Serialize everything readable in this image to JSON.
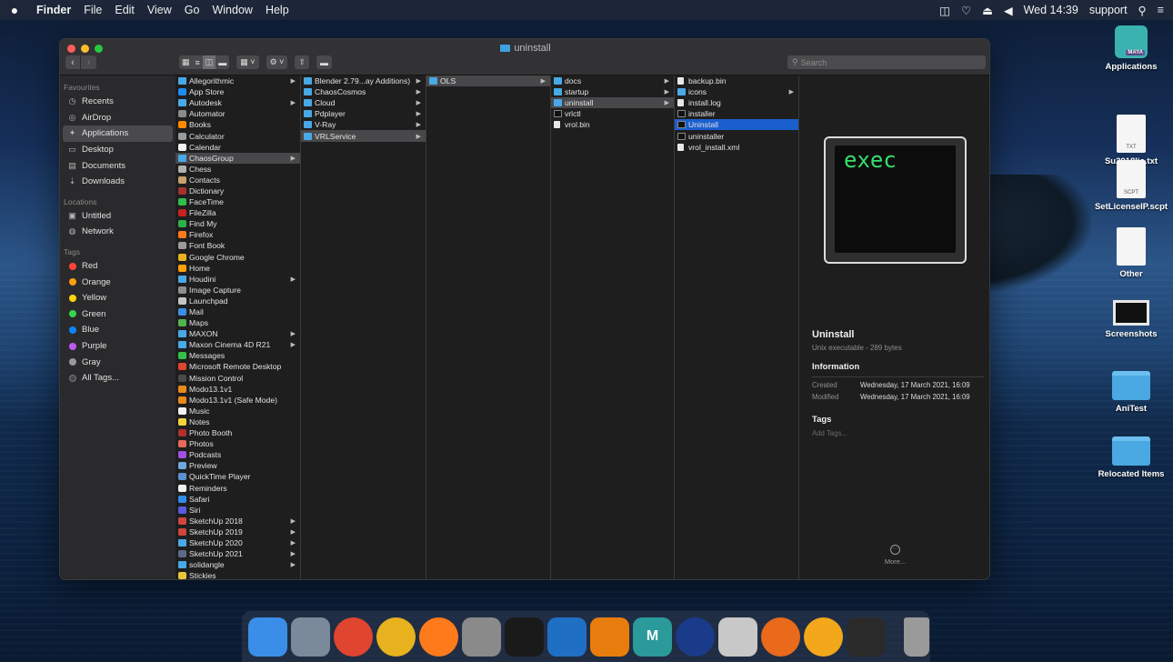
{
  "menubar": {
    "items": [
      "Finder",
      "File",
      "Edit",
      "View",
      "Go",
      "Window",
      "Help"
    ],
    "clock": "Wed 14:39",
    "user": "support"
  },
  "window": {
    "title": "uninstall",
    "search_placeholder": "Search"
  },
  "sidebar": {
    "favourites_heading": "Favourites",
    "favourites": [
      {
        "label": "Recents",
        "icon": "clock-icon"
      },
      {
        "label": "AirDrop",
        "icon": "airdrop-icon"
      },
      {
        "label": "Applications",
        "icon": "applications-icon"
      },
      {
        "label": "Desktop",
        "icon": "desktop-icon"
      },
      {
        "label": "Documents",
        "icon": "documents-icon"
      },
      {
        "label": "Downloads",
        "icon": "downloads-icon"
      }
    ],
    "locations_heading": "Locations",
    "locations": [
      {
        "label": "Untitled",
        "icon": "disk-icon"
      },
      {
        "label": "Network",
        "icon": "globe-icon"
      }
    ],
    "tags_heading": "Tags",
    "tags": [
      {
        "label": "Red",
        "color": "#ff453a"
      },
      {
        "label": "Orange",
        "color": "#ff9f0a"
      },
      {
        "label": "Yellow",
        "color": "#ffd60a"
      },
      {
        "label": "Green",
        "color": "#32d74b"
      },
      {
        "label": "Blue",
        "color": "#0a84ff"
      },
      {
        "label": "Purple",
        "color": "#bf5af2"
      },
      {
        "label": "Gray",
        "color": "#98989d"
      },
      {
        "label": "All Tags...",
        "color": "#4a4a4c"
      }
    ]
  },
  "columns": {
    "applications": [
      {
        "label": "Allegorithmic",
        "type": "folder",
        "chev": true
      },
      {
        "label": "App Store",
        "type": "app",
        "color": "#1c8cf0"
      },
      {
        "label": "Autodesk",
        "type": "folder",
        "chev": true
      },
      {
        "label": "Automator",
        "type": "app",
        "color": "#8a8a8a"
      },
      {
        "label": "Books",
        "type": "app",
        "color": "#ff8a00"
      },
      {
        "label": "Calculator",
        "type": "app",
        "color": "#9a9a9a"
      },
      {
        "label": "Calendar",
        "type": "app",
        "color": "#f2f2f2"
      },
      {
        "label": "ChaosGroup",
        "type": "folder",
        "chev": true,
        "path": true
      },
      {
        "label": "Chess",
        "type": "app",
        "color": "#b0b0b0"
      },
      {
        "label": "Contacts",
        "type": "app",
        "color": "#c8a06a"
      },
      {
        "label": "Dictionary",
        "type": "app",
        "color": "#a5322e"
      },
      {
        "label": "FaceTime",
        "type": "app",
        "color": "#2fbf4a"
      },
      {
        "label": "FileZilla",
        "type": "app",
        "color": "#c7231e"
      },
      {
        "label": "Find My",
        "type": "app",
        "color": "#2cb24a"
      },
      {
        "label": "Firefox",
        "type": "app",
        "color": "#ff7a1a"
      },
      {
        "label": "Font Book",
        "type": "app",
        "color": "#9a9a9a"
      },
      {
        "label": "Google Chrome",
        "type": "app",
        "color": "#e8b21f"
      },
      {
        "label": "Home",
        "type": "app",
        "color": "#ff9f0a"
      },
      {
        "label": "Houdini",
        "type": "folder",
        "chev": true
      },
      {
        "label": "Image Capture",
        "type": "app",
        "color": "#8d8d8d"
      },
      {
        "label": "Launchpad",
        "type": "app",
        "color": "#c5c5c5"
      },
      {
        "label": "Mail",
        "type": "app",
        "color": "#3b8ee8"
      },
      {
        "label": "Maps",
        "type": "app",
        "color": "#4fb34e"
      },
      {
        "label": "MAXON",
        "type": "folder",
        "chev": true
      },
      {
        "label": "Maxon Cinema 4D R21",
        "type": "folder",
        "chev": true
      },
      {
        "label": "Messages",
        "type": "app",
        "color": "#32c24a"
      },
      {
        "label": "Microsoft Remote Desktop",
        "type": "app",
        "color": "#e0452f"
      },
      {
        "label": "Mission Control",
        "type": "app",
        "color": "#4a4a4a"
      },
      {
        "label": "Modo13.1v1",
        "type": "app",
        "color": "#e88a1a"
      },
      {
        "label": "Modo13.1v1 (Safe Mode)",
        "type": "app",
        "color": "#e88a1a"
      },
      {
        "label": "Music",
        "type": "app",
        "color": "#f2f2f2"
      },
      {
        "label": "Notes",
        "type": "app",
        "color": "#f5d23c"
      },
      {
        "label": "Photo Booth",
        "type": "app",
        "color": "#b0302c"
      },
      {
        "label": "Photos",
        "type": "app",
        "color": "#e86a5a"
      },
      {
        "label": "Podcasts",
        "type": "app",
        "color": "#a34fe0"
      },
      {
        "label": "Preview",
        "type": "app",
        "color": "#6fa8dc"
      },
      {
        "label": "QuickTime Player",
        "type": "app",
        "color": "#5a8fd0"
      },
      {
        "label": "Reminders",
        "type": "app",
        "color": "#f0f0f0"
      },
      {
        "label": "Safari",
        "type": "app",
        "color": "#2f8ce8"
      },
      {
        "label": "Siri",
        "type": "app",
        "color": "#5a5ae0"
      },
      {
        "label": "SketchUp 2018",
        "type": "app",
        "color": "#d0463a",
        "chev": true
      },
      {
        "label": "SketchUp 2019",
        "type": "app",
        "color": "#d0463a",
        "chev": true
      },
      {
        "label": "SketchUp 2020",
        "type": "folder",
        "chev": true
      },
      {
        "label": "SketchUp 2021",
        "type": "app",
        "color": "#5a6a8a",
        "chev": true
      },
      {
        "label": "solidangle",
        "type": "folder",
        "chev": true
      },
      {
        "label": "Stickies",
        "type": "app",
        "color": "#e8c53a"
      }
    ],
    "chaosgroup": [
      {
        "label": "Blender 2.79...ay Additions)",
        "type": "folder",
        "chev": true
      },
      {
        "label": "ChaosCosmos",
        "type": "folder",
        "chev": true
      },
      {
        "label": "Cloud",
        "type": "folder",
        "chev": true
      },
      {
        "label": "Pdplayer",
        "type": "folder",
        "chev": true
      },
      {
        "label": "V-Ray",
        "type": "folder",
        "chev": true
      },
      {
        "label": "VRLService",
        "type": "folder",
        "chev": true,
        "path": true
      }
    ],
    "vrlservice": [
      {
        "label": "OLS",
        "type": "folder",
        "chev": true,
        "path": true
      }
    ],
    "ols": [
      {
        "label": "docs",
        "type": "folder",
        "chev": true
      },
      {
        "label": "startup",
        "type": "folder",
        "chev": true
      },
      {
        "label": "uninstall",
        "type": "folder",
        "chev": true,
        "path": true
      },
      {
        "label": "vrlctl",
        "type": "term"
      },
      {
        "label": "vrol.bin",
        "type": "doc"
      }
    ],
    "uninstall": [
      {
        "label": "backup.bin",
        "type": "doc"
      },
      {
        "label": "icons",
        "type": "folder",
        "chev": true
      },
      {
        "label": "install.log",
        "type": "doc"
      },
      {
        "label": "installer",
        "type": "term"
      },
      {
        "label": "Uninstall",
        "type": "term",
        "sel": true
      },
      {
        "label": "uninstaller",
        "type": "term"
      },
      {
        "label": "vrol_install.xml",
        "type": "doc"
      }
    ]
  },
  "preview": {
    "icon_text": "exec",
    "name": "Uninstall",
    "subtitle": "Unix executable - 289 bytes",
    "info_heading": "Information",
    "created_label": "Created",
    "created_value": "Wednesday, 17 March 2021, 16:09",
    "modified_label": "Modified",
    "modified_value": "Wednesday, 17 March 2021, 16:09",
    "tags_heading": "Tags",
    "add_tags": "Add Tags...",
    "more": "More..."
  },
  "desktop": {
    "items": [
      {
        "label": "Applications",
        "kind": "maya",
        "badge": "MAYA"
      },
      {
        "label": "Su2018lic.txt",
        "kind": "doc",
        "badge": "TXT"
      },
      {
        "label": "SetLicenseIP.scpt",
        "kind": "doc",
        "badge": "SCPT"
      },
      {
        "label": "Other",
        "kind": "doc",
        "badge": ""
      },
      {
        "label": "Screenshots",
        "kind": "screen",
        "badge": ""
      },
      {
        "label": "AniTest",
        "kind": "folder",
        "badge": ""
      },
      {
        "label": "Relocated Items",
        "kind": "folder",
        "badge": ""
      }
    ]
  },
  "dock": {
    "apps": [
      {
        "name": "finder-icon",
        "color": "#3b8ee8",
        "glyph": ""
      },
      {
        "name": "launchpad-icon",
        "color": "#7a8a9a",
        "glyph": ""
      },
      {
        "name": "remote-desktop-icon",
        "color": "#e0452f",
        "glyph": ""
      },
      {
        "name": "chrome-icon",
        "color": "#e8b21f",
        "glyph": ""
      },
      {
        "name": "firefox-icon",
        "color": "#ff7a1a",
        "glyph": ""
      },
      {
        "name": "system-preferences-icon",
        "color": "#8a8a8a",
        "glyph": ""
      },
      {
        "name": "terminal-icon",
        "color": "#1a1a1a",
        "glyph": ""
      },
      {
        "name": "sketchup-icon",
        "color": "#1f6fc4",
        "glyph": ""
      },
      {
        "name": "blender-icon",
        "color": "#e87d0d",
        "glyph": ""
      },
      {
        "name": "maya-icon",
        "color": "#2a9a9a",
        "glyph": "M"
      },
      {
        "name": "cinema4d-icon",
        "color": "#1a3a8a",
        "glyph": ""
      },
      {
        "name": "script-editor-icon",
        "color": "#c8c8c8",
        "glyph": ""
      },
      {
        "name": "houdini-icon",
        "color": "#e86a1a",
        "glyph": ""
      },
      {
        "name": "modo-icon",
        "color": "#f2a81a",
        "glyph": ""
      },
      {
        "name": "activity-monitor-icon",
        "color": "#2a2a2a",
        "glyph": ""
      }
    ],
    "trash_color": "#9a9a9a"
  }
}
